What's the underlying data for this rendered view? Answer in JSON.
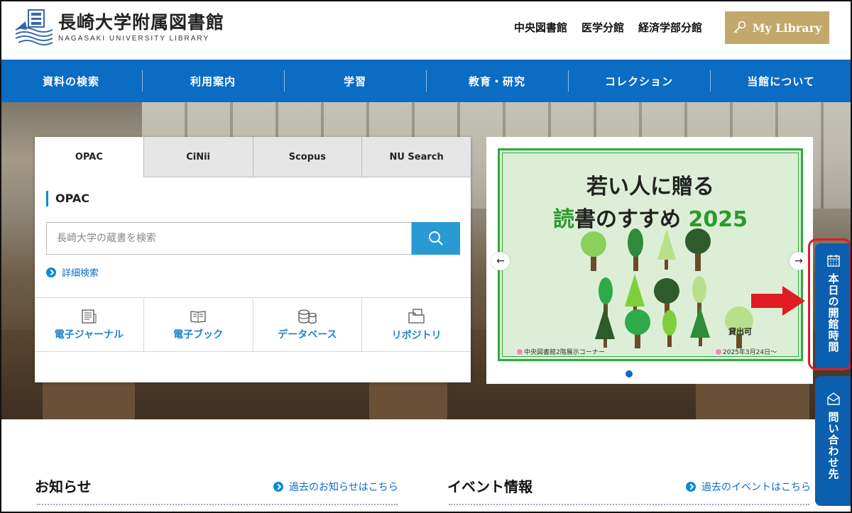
{
  "header": {
    "logo_jp": "長崎大学附属図書館",
    "logo_en": "NAGASAKI UNIVERSITY LIBRARY",
    "branches": [
      "中央図書館",
      "医学分館",
      "経済学部分館"
    ],
    "mylibrary_label": "My Library"
  },
  "nav": {
    "items": [
      "資料の検索",
      "利用案内",
      "学習",
      "教育・研究",
      "コレクション",
      "当館について"
    ]
  },
  "search": {
    "tabs": [
      "OPAC",
      "CiNii",
      "Scopus",
      "NU Search"
    ],
    "active_tab": "OPAC",
    "section_title": "OPAC",
    "placeholder": "長崎大学の蔵書を検索",
    "advanced_label": "詳細検索",
    "quick_links": [
      {
        "label": "電子ジャーナル",
        "icon": "journal-icon"
      },
      {
        "label": "電子ブック",
        "icon": "book-icon"
      },
      {
        "label": "データベース",
        "icon": "database-icon"
      },
      {
        "label": "リポジトリ",
        "icon": "folder-icon"
      }
    ]
  },
  "banner": {
    "title_line1": "若い人に贈る",
    "title_line2_a": "読",
    "title_line2_b": "書",
    "title_line2_c": "のすすめ ",
    "title_line2_year": "2025",
    "foot_left": "中央図書館2階展示コーナー",
    "foot_right": "2025年3月24日～",
    "lend_label": "貸出可",
    "prev_arrow": "←",
    "next_arrow": "→"
  },
  "side": {
    "hours_label": "本日の開館時間",
    "contact_label": "問い合わせ先"
  },
  "bottom": {
    "news_title": "お知らせ",
    "news_more": "過去のお知らせはこちら",
    "events_title": "イベント情報",
    "events_more": "過去のイベントはこちら"
  },
  "colors": {
    "nav_blue": "#0b6cc4",
    "gold": "#c2a86a",
    "banner_green": "#2eaa3d",
    "highlight_red": "#e01b24"
  }
}
